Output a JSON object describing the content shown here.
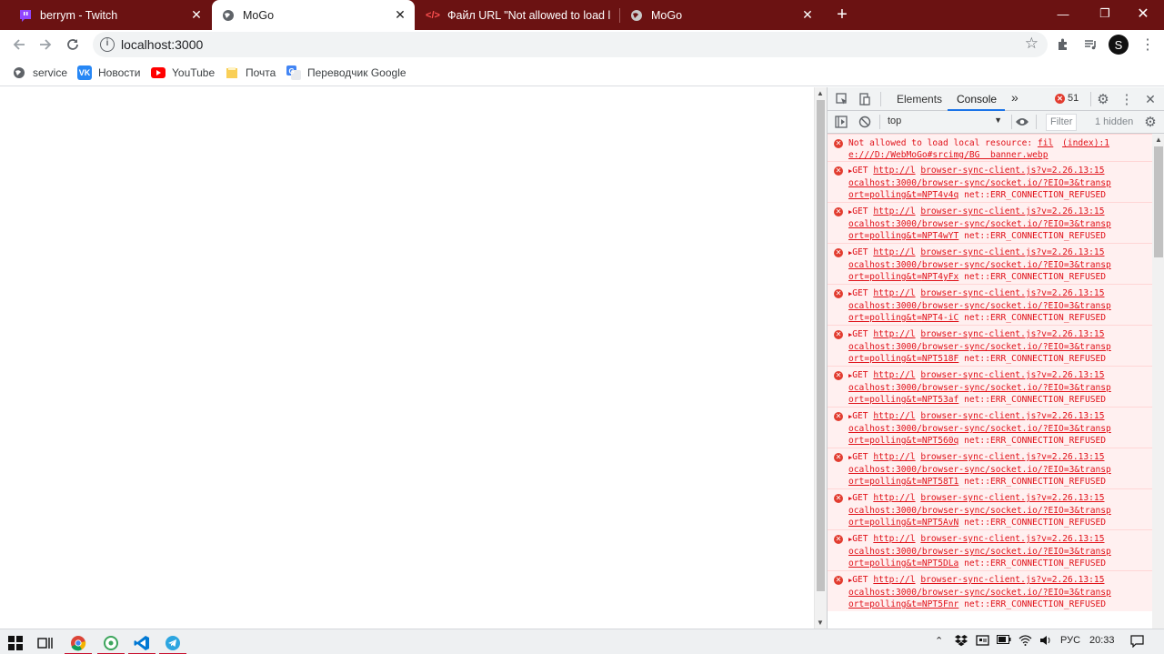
{
  "tabs": [
    {
      "title": "berrym - Twitch",
      "icon": "twitch-icon"
    },
    {
      "title": "MoGo",
      "icon": "globe-icon",
      "active": true
    },
    {
      "title": "Файл URL \"Not allowed to load l",
      "icon": "code-icon"
    },
    {
      "title": "MoGo",
      "icon": "globe-icon"
    }
  ],
  "omnibox": {
    "url": "localhost:3000"
  },
  "profile_initial": "S",
  "bookmarks": [
    {
      "label": "service",
      "icon": "globe-icon"
    },
    {
      "label": "Новости",
      "icon": "vk-icon",
      "badge": "VK"
    },
    {
      "label": "YouTube",
      "icon": "youtube-icon"
    },
    {
      "label": "Почта",
      "icon": "folder-icon"
    },
    {
      "label": "Переводчик Google",
      "icon": "google-translate-icon"
    }
  ],
  "devtools": {
    "tabs": [
      "Elements",
      "Console"
    ],
    "active_tab": "Console",
    "error_count": "51",
    "context": "top",
    "filter_placeholder": "Filter",
    "hidden": "1 hidden",
    "first_message": {
      "text1": "Not allowed to load local resource: ",
      "link1": "fil",
      "src": "(index):1",
      "line2": "e:///D:/WebMoGo#srcimg/BG  banner.webp"
    },
    "get_entries": [
      {
        "suffix": "NPT4v4q"
      },
      {
        "suffix": "NPT4wYT"
      },
      {
        "suffix": "NPT4yFx"
      },
      {
        "suffix": "NPT4-iC"
      },
      {
        "suffix": "NPT518F"
      },
      {
        "suffix": "NPT53af"
      },
      {
        "suffix": "NPT560q"
      },
      {
        "suffix": "NPT58T1"
      },
      {
        "suffix": "NPT5AvN"
      },
      {
        "suffix": "NPT5DLa"
      },
      {
        "suffix": "NPT5Fnr"
      }
    ],
    "get_text": {
      "method": "GET",
      "url_head": "http://l",
      "source": "browser-sync-client.js?v=2.26.13:15",
      "url_line2": "ocalhost:3000/browser-sync/socket.io/?EIO=3&transp",
      "url_line3_prefix": "ort=polling&t=",
      "error": "net::ERR_CONNECTION_REFUSED"
    }
  },
  "taskbar": {
    "lang": "РУС",
    "time": "20:33"
  },
  "colors": {
    "tabstrip": "#6b1212",
    "console_error": "#e0121a"
  }
}
